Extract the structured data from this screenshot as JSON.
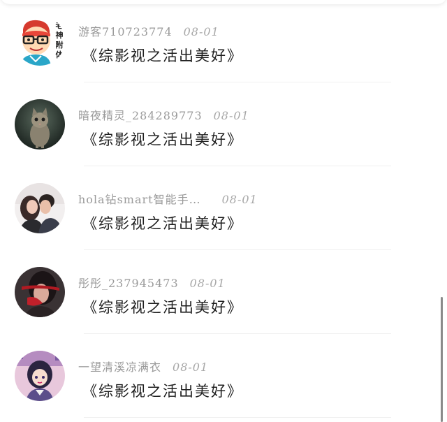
{
  "comments": [
    {
      "user": "游客710723774",
      "date": "08-01",
      "text": "《综影视之活出美好》",
      "avatar_icon": "cartoon-boy-avatar-icon"
    },
    {
      "user": "暗夜精灵_284289773",
      "date": "08-01",
      "text": "《综影视之活出美好》",
      "avatar_icon": "kitten-avatar-icon"
    },
    {
      "user": "hola钻smart智能手…",
      "date": "08-01",
      "text": "《综影视之活出美好》",
      "avatar_icon": "couple-avatar-icon"
    },
    {
      "user": "彤彤_237945473",
      "date": "08-01",
      "text": "《综影视之活出美好》",
      "avatar_icon": "girl-red-veil-avatar-icon"
    },
    {
      "user": "一望清溪凉满衣",
      "date": "08-01",
      "text": "《综影视之活出美好》",
      "avatar_icon": "anime-girl-avatar-icon"
    }
  ],
  "avatar_badge_text": [
    "老",
    "神",
    "附",
    "体"
  ],
  "colors": {
    "username": "#9a9a9a",
    "comment_text": "#1f1f1f",
    "background": "#ffffff",
    "scrollbar": "#8a8a8a"
  }
}
